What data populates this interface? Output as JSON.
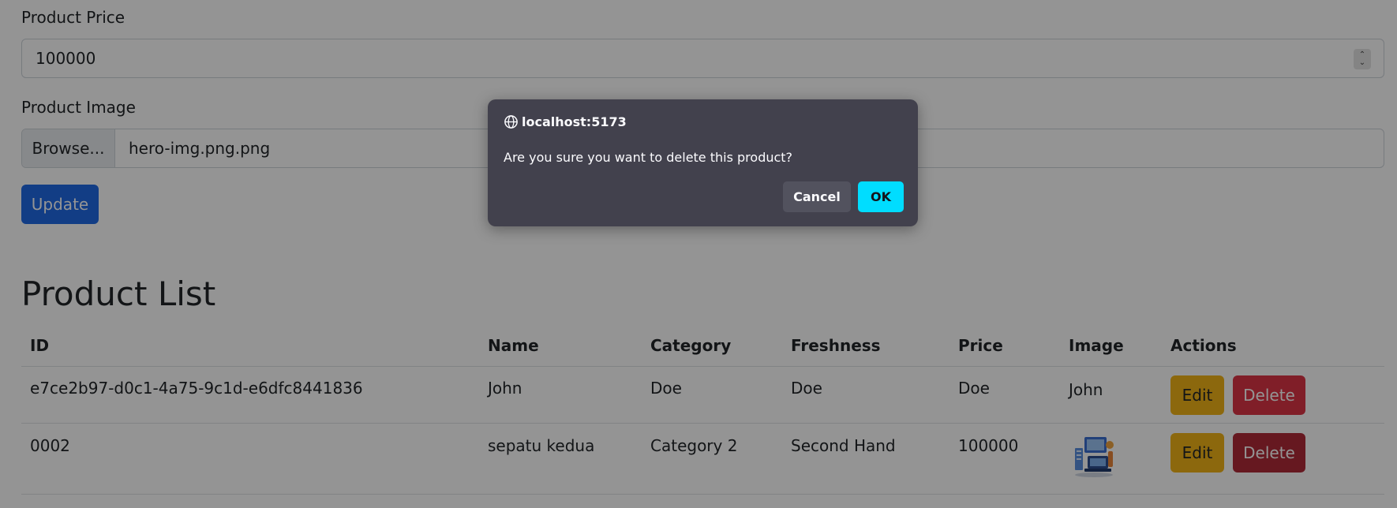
{
  "form": {
    "price_label": "Product Price",
    "price_value": "100000",
    "image_label": "Product Image",
    "browse_label": "Browse...",
    "file_name": "hero-img.png.png",
    "update_label": "Update"
  },
  "list": {
    "title": "Product List",
    "headers": [
      "ID",
      "Name",
      "Category",
      "Freshness",
      "Price",
      "Image",
      "Actions"
    ],
    "rows": [
      {
        "id": "e7ce2b97-d0c1-4a75-9c1d-e6dfc8441836",
        "name": "John",
        "category": "Doe",
        "freshness": "Doe",
        "price": "Doe",
        "image_text": "John",
        "edit_label": "Edit",
        "delete_label": "Delete"
      },
      {
        "id": "0002",
        "name": "sepatu kedua",
        "category": "Category 2",
        "freshness": "Second Hand",
        "price": "100000",
        "image_icon": "product-thumbnail-icon",
        "edit_label": "Edit",
        "delete_label": "Delete"
      }
    ]
  },
  "dialog": {
    "origin": "localhost:5173",
    "message": "Are you sure you want to delete this product?",
    "cancel_label": "Cancel",
    "ok_label": "OK"
  },
  "colors": {
    "primary": "#1f6ae5",
    "warning": "#f2b417",
    "danger": "#dc3545",
    "dialog_bg": "#42414d",
    "ok_accent": "#00ddff"
  }
}
